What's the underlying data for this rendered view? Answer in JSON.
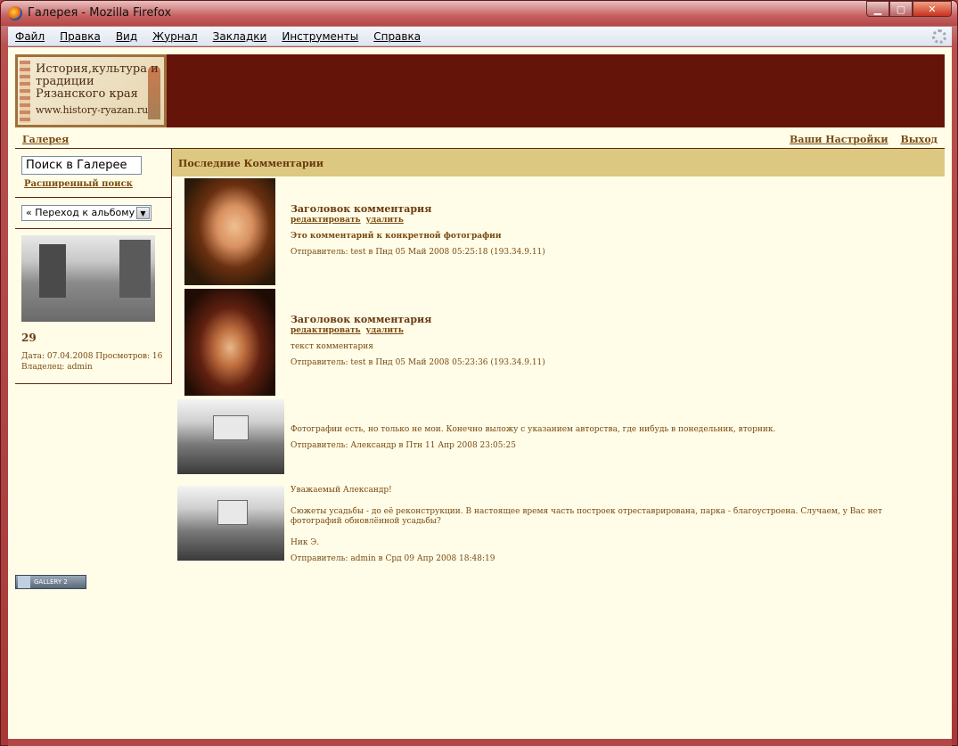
{
  "window": {
    "title": "Галерея - Mozilla Firefox",
    "btn_min": "▁",
    "btn_max": "▢",
    "btn_close": "✕"
  },
  "menu": [
    "Файл",
    "Правка",
    "Вид",
    "Журнал",
    "Закладки",
    "Инструменты",
    "Справка"
  ],
  "banner": {
    "logo_text": "История,культура и традиции Рязанского края",
    "logo_url": "www.history-ryazan.ru"
  },
  "nav": {
    "breadcrumb": "Галерея",
    "settings": "Ваши Настройки",
    "logout": "Выход"
  },
  "sidebar": {
    "search_value": "Поиск в Галерее",
    "advanced_search": "Расширенный поиск",
    "album_jump": "« Переход к альбому »",
    "item_title": "29",
    "item_meta_line1": "Дата: 07.04.2008 Просмотров: 16",
    "item_meta_line2": "Владелец: admin"
  },
  "main": {
    "header": "Последние Комментарии",
    "comments": [
      {
        "title": "Заголовок комментария",
        "edit": "редактировать",
        "delete": "удалить",
        "body": "Это комментарий к конкретной фотографии",
        "sender": "Отправитель: test в Пнд 05 Май 2008 05:25:18 (193.34.9.11)"
      },
      {
        "title": "Заголовок комментария",
        "edit": "редактировать",
        "delete": "удалить",
        "body": "текст комментария",
        "sender": "Отправитель: test в Пнд 05 Май 2008 05:23:36 (193.34.9.11)"
      },
      {
        "body": "Фотографии есть, но только не мои. Конечно выложу с указанием авторства, где нибудь в понедельник, вторник.",
        "sender": "Отправитель: Александр в Птн 11 Апр 2008 23:05:25"
      },
      {
        "body_line1": "Уважаемый Александр!",
        "body_line2": "Сюжеты усадьбы - до её реконструкции. В настоящее время часть построек отреставрирована, парка - благоустроена. Случаем, у Вас нет фотографий обновлённой усадьбы?",
        "body_line3": "Ник Э.",
        "sender": "Отправитель: admin в Срд 09 Апр 2008 18:48:19"
      }
    ]
  },
  "footer": {
    "badge": "GALLERY 2"
  }
}
